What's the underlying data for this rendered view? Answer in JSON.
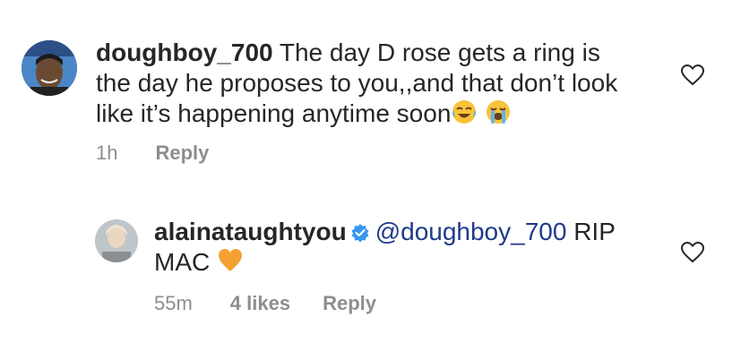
{
  "comments": [
    {
      "username": "doughboy_700",
      "text_line1": "The day D rose gets a ring is",
      "text_line2": "the day he proposes to you,,and that don’t look",
      "text_line3": "like it’s happening anytime soon",
      "emojis": [
        "face-with-tears-of-joy-icon",
        "loudly-crying-face-icon"
      ],
      "time": "1h",
      "reply_label": "Reply"
    },
    {
      "username": "alainataughtyou",
      "verified": true,
      "mention": "@doughboy_700",
      "text_line1": "RIP",
      "text_line2": "MAC",
      "emoji": "orange-heart-icon",
      "time": "55m",
      "likes": "4 likes",
      "reply_label": "Reply"
    }
  ],
  "colors": {
    "text": "#262626",
    "meta": "#8e8e8e",
    "mention": "#1e3a8a",
    "verified": "#3897f0",
    "orange_heart": "#f5a033"
  }
}
